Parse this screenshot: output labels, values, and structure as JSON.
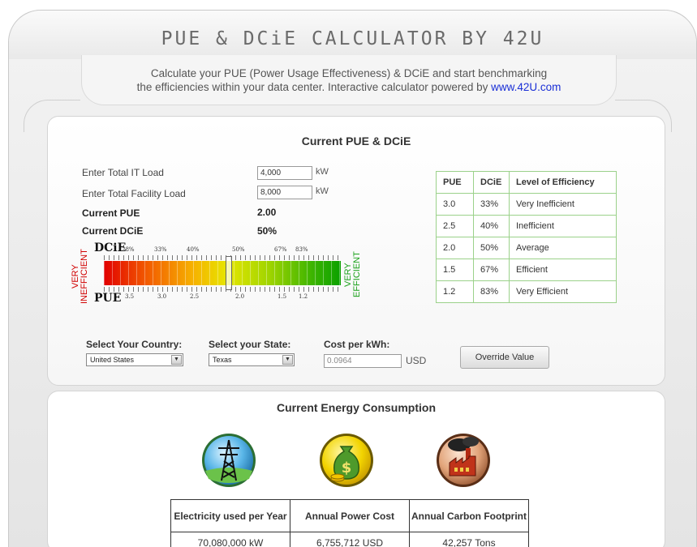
{
  "header": {
    "title": "PUE & DCiE CALCULATOR BY 42U",
    "intro_line1": "Calculate your PUE (Power Usage Effectiveness) & DCiE and start benchmarking",
    "intro_line2_prefix": "the efficiencies within your data center. Interactive calculator powered by ",
    "intro_link": "www.42U.com"
  },
  "current_pue": {
    "title": "Current PUE & DCiE",
    "it_load_label": "Enter Total IT Load",
    "it_load_value": "4,000",
    "it_load_unit": "kW",
    "facility_load_label": "Enter Total Facility Load",
    "facility_load_value": "8,000",
    "facility_load_unit": "kW",
    "pue_label": "Current PUE",
    "pue_value": "2.00",
    "dcie_label": "Current DCiE",
    "dcie_value": "50%",
    "gauge": {
      "dcie_label": "DCiE",
      "pue_label": "PUE",
      "left_label": "VERY INEFFICIENT",
      "right_label": "VERY EFFICIENT",
      "dcie_ticks": [
        "28%",
        "33%",
        "40%",
        "50%",
        "67%",
        "83%"
      ],
      "pue_ticks": [
        "3.5",
        "3.0",
        "2.5",
        "2.0",
        "1.5",
        "1.2"
      ],
      "marker_fraction": 0.5
    },
    "efficiency_table": {
      "headers": [
        "PUE",
        "DCiE",
        "Level of Efficiency"
      ],
      "rows": [
        [
          "3.0",
          "33%",
          "Very Inefficient"
        ],
        [
          "2.5",
          "40%",
          "Inefficient"
        ],
        [
          "2.0",
          "50%",
          "Average"
        ],
        [
          "1.5",
          "67%",
          "Efficient"
        ],
        [
          "1.2",
          "83%",
          "Very Efficient"
        ]
      ]
    },
    "country_label": "Select Your Country:",
    "country_value": "United States",
    "state_label": "Select your State:",
    "state_value": "Texas",
    "cost_label": "Cost per kWh:",
    "cost_value": "0.0964",
    "cost_unit": "USD",
    "override_label": "Override Value"
  },
  "energy": {
    "title": "Current Energy Consumption",
    "headers": [
      "Electricity used per Year",
      "Annual Power Cost",
      "Annual Carbon Footprint"
    ],
    "values": [
      "70,080,000 kW",
      "6,755,712 USD",
      "42,257 Tons"
    ],
    "icons": [
      "power-tower-icon",
      "money-bag-icon",
      "factory-icon"
    ]
  },
  "colors": {
    "efficient_green": "#1aa11a",
    "inefficient_red": "#d00000",
    "link_blue": "#1a2fd6",
    "table_border_green": "#9bd18a"
  }
}
